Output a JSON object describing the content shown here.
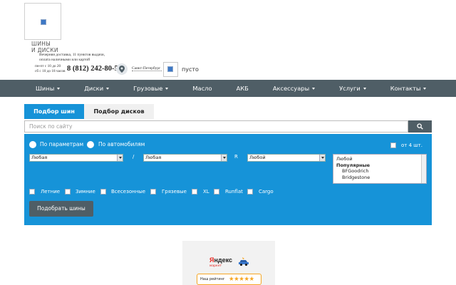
{
  "header": {
    "brand_line1": "ШИНЫ",
    "brand_line2": "И ДИСКИ",
    "tagline_line1": "Вечерняя доставка, 11 пунктов выдачи,",
    "tagline_line2": "оплата наличными или картой",
    "hours_line1": "пн-пт с 10 до 20",
    "hours_line2": "сб с 10 до 18 часов",
    "phone": "8 (812) 242-80-50",
    "city": "Санкт-Петербург",
    "cart_status": "пусто"
  },
  "nav": {
    "items": [
      {
        "label": "Шины",
        "has_dropdown": true
      },
      {
        "label": "Диски",
        "has_dropdown": true
      },
      {
        "label": "Грузовые",
        "has_dropdown": true
      },
      {
        "label": "Масло",
        "has_dropdown": false
      },
      {
        "label": "АКБ",
        "has_dropdown": false
      },
      {
        "label": "Аксессуары",
        "has_dropdown": true
      },
      {
        "label": "Услуги",
        "has_dropdown": true
      },
      {
        "label": "Контакты",
        "has_dropdown": true
      }
    ]
  },
  "tabs": {
    "tires": "Подбор шин",
    "discs": "Подбор дисков",
    "active": "tires"
  },
  "search": {
    "placeholder": "Поиск по сайту",
    "value": ""
  },
  "filter": {
    "radio_params": "По параметрам",
    "radio_auto": "По автомобилям",
    "width_value": "Любая",
    "height_value": "Любая",
    "radius_label": "R",
    "radius_value": "Любой",
    "separator": "/",
    "qty_label": "от 4 шт.",
    "brands": {
      "any": "Любой",
      "group_label": "Популярные",
      "options": [
        "BFGoodrich",
        "Bridgestone"
      ]
    },
    "seasons": {
      "summer": "Летние",
      "winter": "Зимние",
      "all_season": "Всесезонные",
      "mud": "Грязевые",
      "xl": "XL",
      "runflat": "Runflat",
      "cargo": "Cargo"
    },
    "submit_label": "Подобрать шины"
  },
  "widget": {
    "title_ya": "Я",
    "title_rest": "ндекс",
    "subtitle": "маркет",
    "rating_label": "Наш рейтинг",
    "stars": "★★★★★",
    "rating_value": 5,
    "star_color": "#f6a623"
  },
  "colors": {
    "accent": "#1693d8",
    "nav_bg": "#4f5e66"
  }
}
